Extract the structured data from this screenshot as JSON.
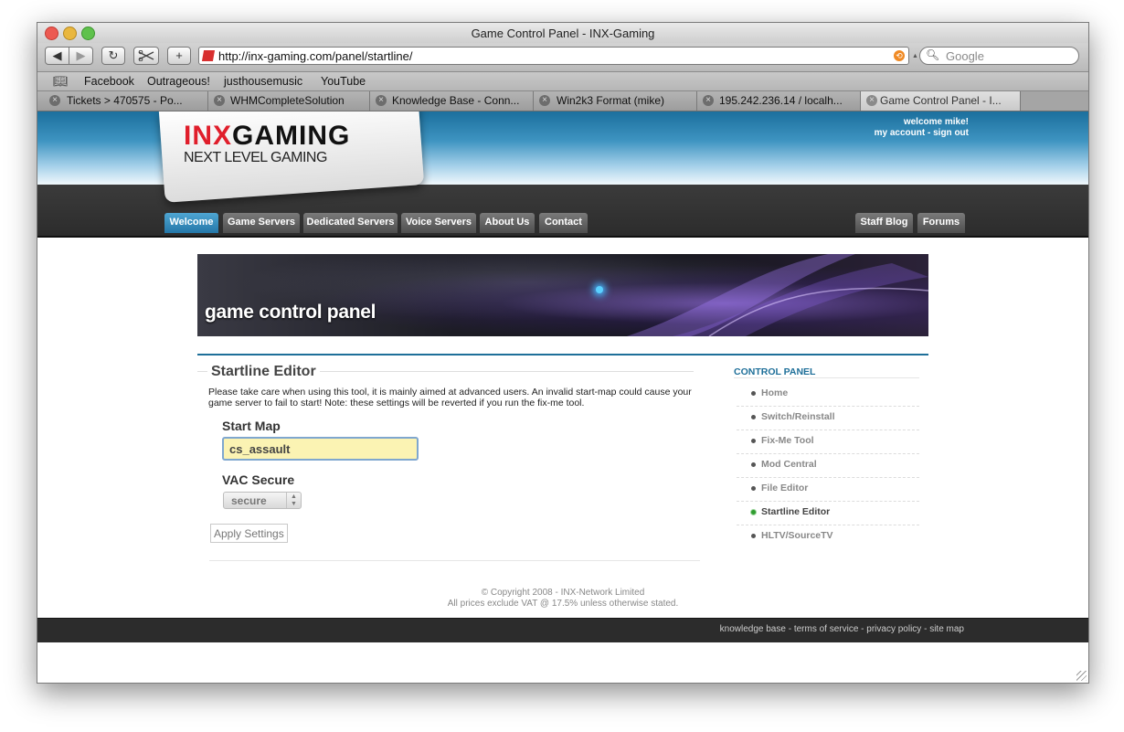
{
  "window": {
    "title": "Game Control Panel - INX-Gaming"
  },
  "toolbar": {
    "back_glyph": "◀",
    "forward_glyph": "▶",
    "reload_glyph": "↻",
    "add_glyph": "+",
    "url": "http://inx-gaming.com/panel/startline/",
    "search_placeholder": "Google"
  },
  "bookmarks": [
    "Facebook",
    "Outrageous!",
    "justhousemusic",
    "YouTube"
  ],
  "tabs": [
    {
      "title": "Tickets > 470575 - Po..."
    },
    {
      "title": "WHMCompleteSolution"
    },
    {
      "title": "Knowledge Base - Conn..."
    },
    {
      "title": "Win2k3 Format (mike)"
    },
    {
      "title": "195.242.236.14 / localh..."
    },
    {
      "title": "Game Control Panel - I..."
    }
  ],
  "site": {
    "logo_inx": "INX",
    "logo_gaming": "GAMING",
    "tagline": "NEXT LEVEL GAMING",
    "welcome_prefix": "welcome",
    "welcome_user": "mike!",
    "account_link": "my account",
    "sep": " - ",
    "signout_link": "sign out",
    "nav_left": [
      "Welcome",
      "Game Servers",
      "Dedicated Servers",
      "Voice Servers",
      "About Us",
      "Contact"
    ],
    "nav_right": [
      "Staff Blog",
      "Forums"
    ],
    "banner_title": "game control panel"
  },
  "editor": {
    "title": "Startline Editor",
    "intro": "Please take care when using this tool, it is mainly aimed at advanced users. An invalid start-map could cause your game server to fail to start! Note: these settings will be reverted if you run the fix-me tool.",
    "start_map_label": "Start Map",
    "start_map_value": "cs_assault",
    "vac_label": "VAC Secure",
    "vac_value": "secure",
    "apply_label": "Apply Settings"
  },
  "sidebar": {
    "heading": "CONTROL PANEL",
    "items": [
      "Home",
      "Switch/Reinstall",
      "Fix-Me Tool",
      "Mod Central",
      "File Editor",
      "Startline Editor",
      "HLTV/SourceTV"
    ],
    "active": "Startline Editor"
  },
  "footer": {
    "copyright": "© Copyright 2008 - INX-Network Limited",
    "vat": "All prices exclude VAT @ 17.5% unless otherwise stated.",
    "links": [
      "knowledge base",
      "terms of service",
      "privacy policy",
      "site map"
    ],
    "link_sep": " - "
  }
}
